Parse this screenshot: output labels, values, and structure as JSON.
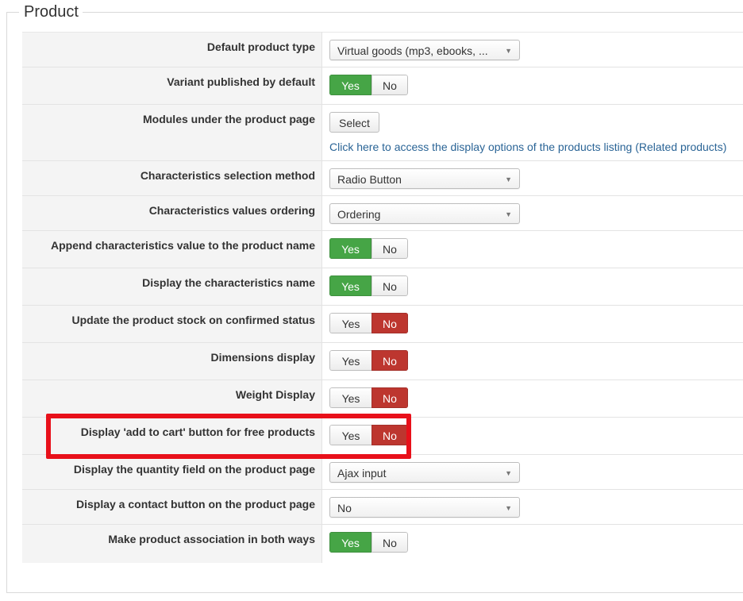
{
  "fieldset": {
    "legend": "Product"
  },
  "rows": [
    {
      "label": "Default product type",
      "type": "select",
      "value": "Virtual goods (mp3, ebooks, ..."
    },
    {
      "label": "Variant published by default",
      "type": "toggle",
      "yes": "Yes",
      "no": "No",
      "state": "yes"
    },
    {
      "label": "Modules under the product page",
      "type": "button_link",
      "button": "Select",
      "link": "Click here to access the display options of the products listing (Related products)"
    },
    {
      "label": "Characteristics selection method",
      "type": "select",
      "value": "Radio Button"
    },
    {
      "label": "Characteristics values ordering",
      "type": "select",
      "value": "Ordering"
    },
    {
      "label": "Append characteristics value to the product name",
      "type": "toggle",
      "yes": "Yes",
      "no": "No",
      "state": "yes"
    },
    {
      "label": "Display the characteristics name",
      "type": "toggle",
      "yes": "Yes",
      "no": "No",
      "state": "yes"
    },
    {
      "label": "Update the product stock on confirmed status",
      "type": "toggle",
      "yes": "Yes",
      "no": "No",
      "state": "no"
    },
    {
      "label": "Dimensions display",
      "type": "toggle",
      "yes": "Yes",
      "no": "No",
      "state": "no"
    },
    {
      "label": "Weight Display",
      "type": "toggle",
      "yes": "Yes",
      "no": "No",
      "state": "no"
    },
    {
      "label": "Display 'add to cart' button for free products",
      "type": "toggle",
      "yes": "Yes",
      "no": "No",
      "state": "no"
    },
    {
      "label": "Display the quantity field on the product page",
      "type": "select",
      "value": "Ajax input"
    },
    {
      "label": "Display a contact button on the product page",
      "type": "select",
      "value": "No"
    },
    {
      "label": "Make product association in both ways",
      "type": "toggle",
      "yes": "Yes",
      "no": "No",
      "state": "yes"
    }
  ],
  "colors": {
    "yes_active": "#46a546",
    "no_active": "#bd362f",
    "link": "#2a6496",
    "highlight": "#e8101a"
  },
  "icons": {
    "select_caret": "caret-down-icon"
  }
}
